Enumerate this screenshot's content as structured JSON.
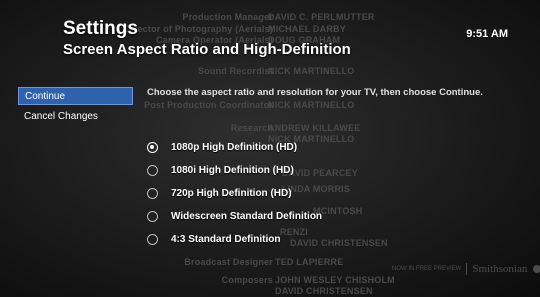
{
  "header": {
    "title": "Settings",
    "subtitle": "Screen Aspect Ratio and High-Definition",
    "time": "9:51 AM"
  },
  "menu": [
    {
      "label": "Continue",
      "selected": true
    },
    {
      "label": "Cancel Changes",
      "selected": false
    }
  ],
  "prompt": "Choose the aspect ratio and resolution for your TV, then choose Continue.",
  "options": [
    {
      "label": "1080p High Definition (HD)",
      "checked": true
    },
    {
      "label": "1080i High Definition (HD)",
      "checked": false
    },
    {
      "label": "720p High Definition (HD)",
      "checked": false
    },
    {
      "label": "Widescreen Standard Definition",
      "checked": false
    },
    {
      "label": "4:3 Standard Definition",
      "checked": false
    }
  ],
  "background_credits": [
    {
      "role": "Production Manager",
      "name": "DAVID C. PERLMUTTER"
    },
    {
      "role": "Director of Photography (Aerials)",
      "name": "MICHAEL DARBY"
    },
    {
      "role": "Camera Operator (Aerials)",
      "name": "DOUG GRAHAM"
    },
    {
      "role": "Sound Recordist",
      "name": "NICK MARTINELLO"
    },
    {
      "role": "Post Production Coordinator",
      "name": "NICK MARTINELLO"
    },
    {
      "role": "Research",
      "name": "ANDREW KILLAWEE"
    },
    {
      "role": "",
      "name": "NICK MARTINELLO"
    },
    {
      "role": "",
      "name": "DAVID PEARCEY"
    },
    {
      "role": "",
      "name": "LINDA MORRIS"
    },
    {
      "role": "",
      "name": "MCINTOSH"
    },
    {
      "role": "",
      "name": "RENZI"
    },
    {
      "role": "",
      "name": "DAVID CHRISTENSEN"
    },
    {
      "role": "Broadcast Designer",
      "name": "TED LAPIERRE"
    },
    {
      "role": "Composers",
      "name": "JOHN WESLEY CHISHOLM"
    },
    {
      "role": "",
      "name": "DAVID CHRISTENSEN"
    }
  ],
  "logo": {
    "left": "NOW IN FREE PREVIEW",
    "right": "Smithsonian"
  }
}
